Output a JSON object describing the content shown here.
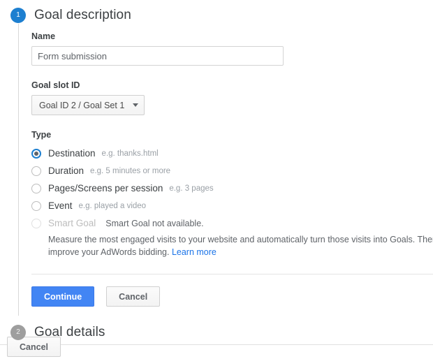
{
  "wizard": {
    "step1": {
      "badge": "1",
      "heading": "Goal description",
      "name_label": "Name",
      "name_value": "Form submission",
      "name_placeholder": "",
      "slot_label": "Goal slot ID",
      "slot_value": "Goal ID 2 / Goal Set 1",
      "type_label": "Type",
      "types": [
        {
          "label": "Destination",
          "hint": "e.g. thanks.html",
          "selected": true,
          "disabled": false
        },
        {
          "label": "Duration",
          "hint": "e.g. 5 minutes or more",
          "selected": false,
          "disabled": false
        },
        {
          "label": "Pages/Screens per session",
          "hint": "e.g. 3 pages",
          "selected": false,
          "disabled": false
        },
        {
          "label": "Event",
          "hint": "e.g. played a video",
          "selected": false,
          "disabled": false
        }
      ],
      "smart_goal": {
        "label": "Smart Goal",
        "status": "Smart Goal not available.",
        "description_line1": "Measure the most engaged visits to your website and automatically turn those visits into Goals. Then use those",
        "description_line2": "improve your AdWords bidding.",
        "learn_more": "Learn more"
      },
      "continue_label": "Continue",
      "cancel_label": "Cancel"
    },
    "step2": {
      "badge": "2",
      "heading": "Goal details"
    }
  },
  "footer": {
    "cancel_label": "Cancel"
  },
  "colors": {
    "accent_blue": "#1d7fd0",
    "primary_button": "#4285f4",
    "link_blue": "#1a73e8",
    "inactive_gray": "#9e9e9e"
  }
}
